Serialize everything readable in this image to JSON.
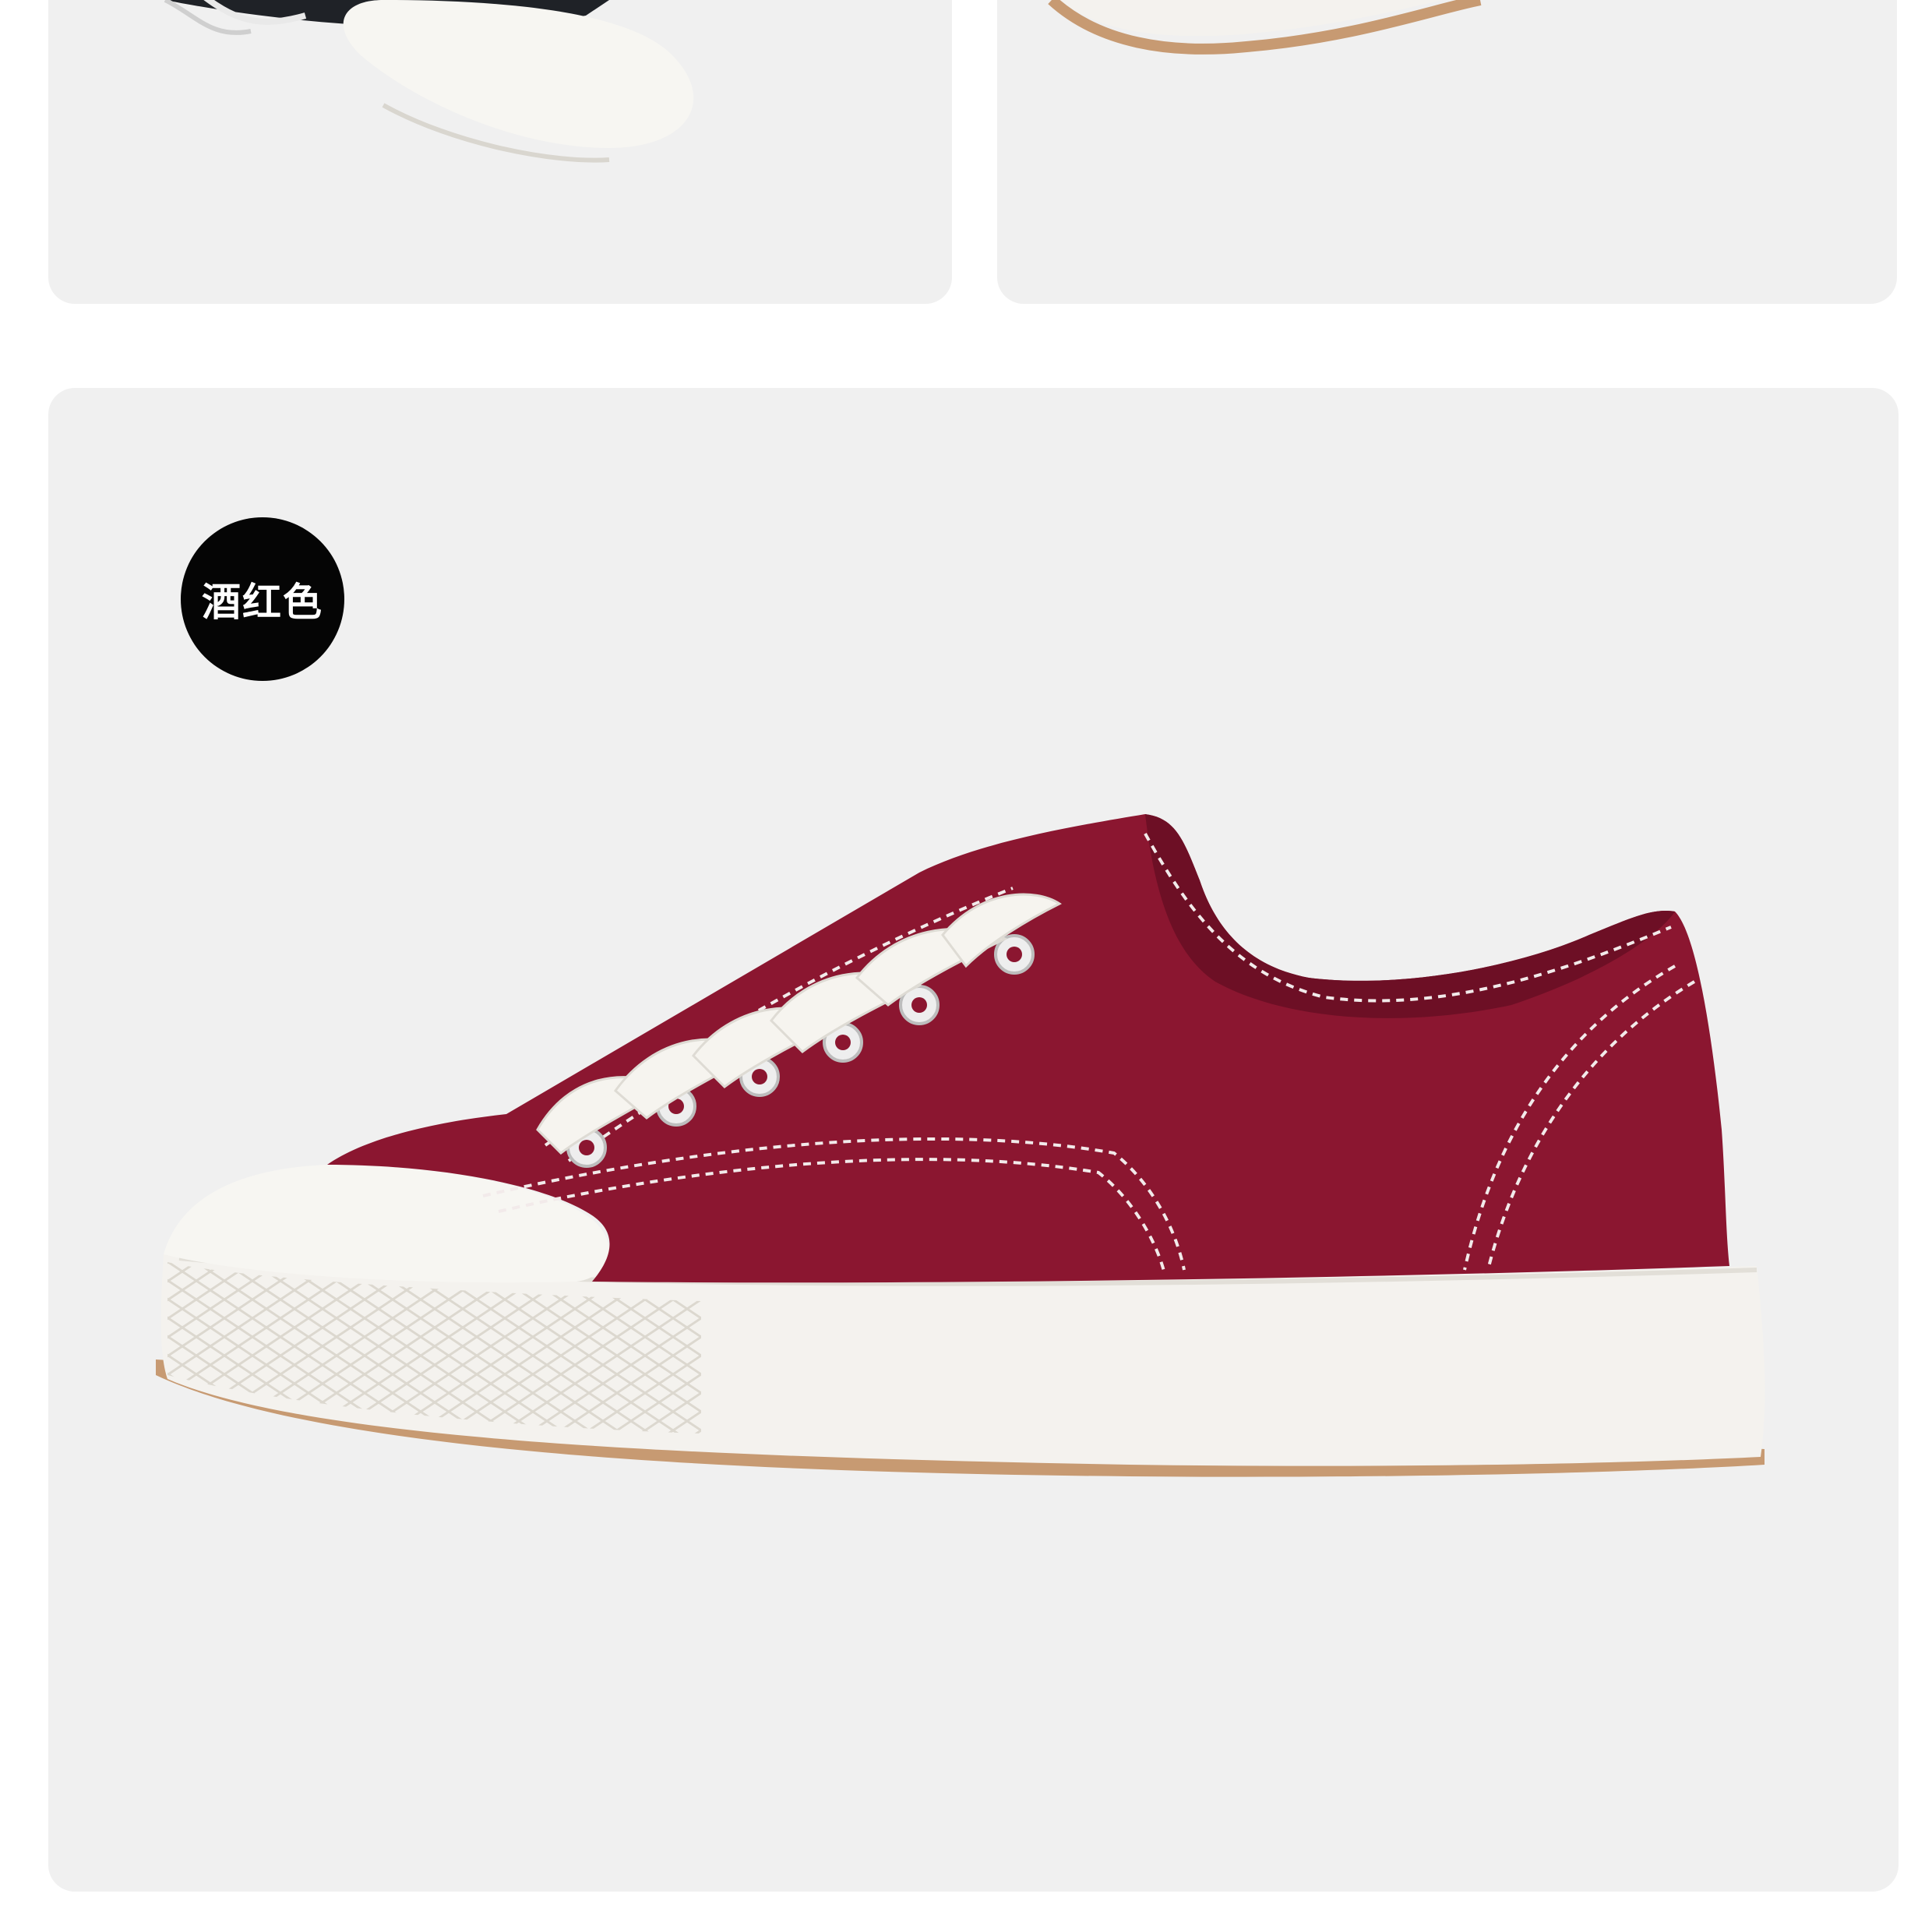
{
  "product_gallery": {
    "color_badge_label": "酒红色",
    "colors": {
      "upper": "#8b1630",
      "upper_dark": "#6d0f25",
      "sole": "#f4f2ee",
      "gum_outsole": "#c79a72",
      "top_left_upper": "#1f2227"
    },
    "images": [
      {
        "shoe": "black-canvas-sneaker-partial",
        "icon": "sneaker-photo"
      },
      {
        "shoe": "sneaker-sole-partial",
        "icon": "sneaker-photo"
      },
      {
        "shoe": "burgundy-low-top-canvas-sneaker",
        "icon": "sneaker-photo"
      }
    ]
  }
}
